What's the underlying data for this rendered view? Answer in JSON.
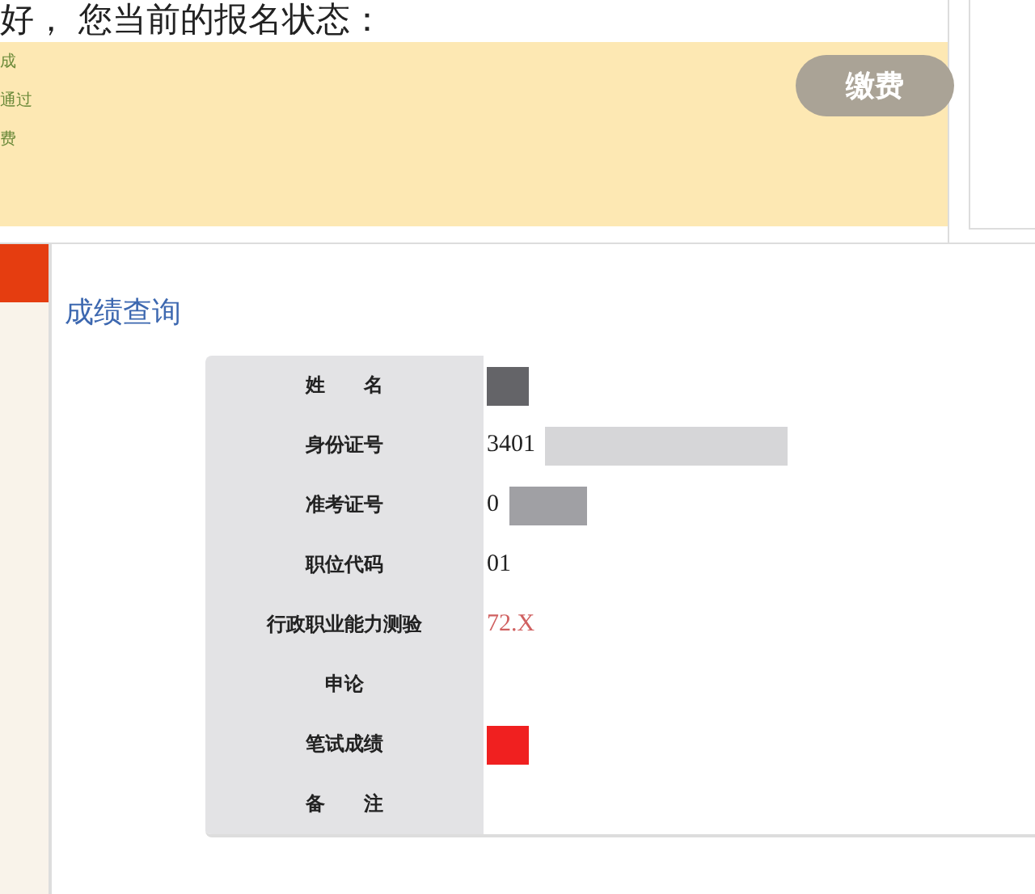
{
  "status_heading": "好， 您当前的报名状态：",
  "status_panel": {
    "steps": [
      "成",
      "通过",
      "费"
    ],
    "button": "缴费",
    "button_disabled": true
  },
  "section_title": "成绩查询",
  "rows": [
    {
      "label": "姓　　名",
      "value": "",
      "color": "#646468"
    },
    {
      "label": "身份证号",
      "value": "3401",
      "color": "#d6d6d8"
    },
    {
      "label": "准考证号",
      "value": "0",
      "color": "#a0a0a4"
    },
    {
      "label": "职位代码",
      "value": "01"
    },
    {
      "label": "行政职业能力测验",
      "value": "72.X",
      "highlight": true
    },
    {
      "label": "申论",
      "value": ""
    },
    {
      "label": "笔试成绩",
      "value": "",
      "color": "#f02020"
    },
    {
      "label": "备　　注",
      "value": ""
    }
  ]
}
